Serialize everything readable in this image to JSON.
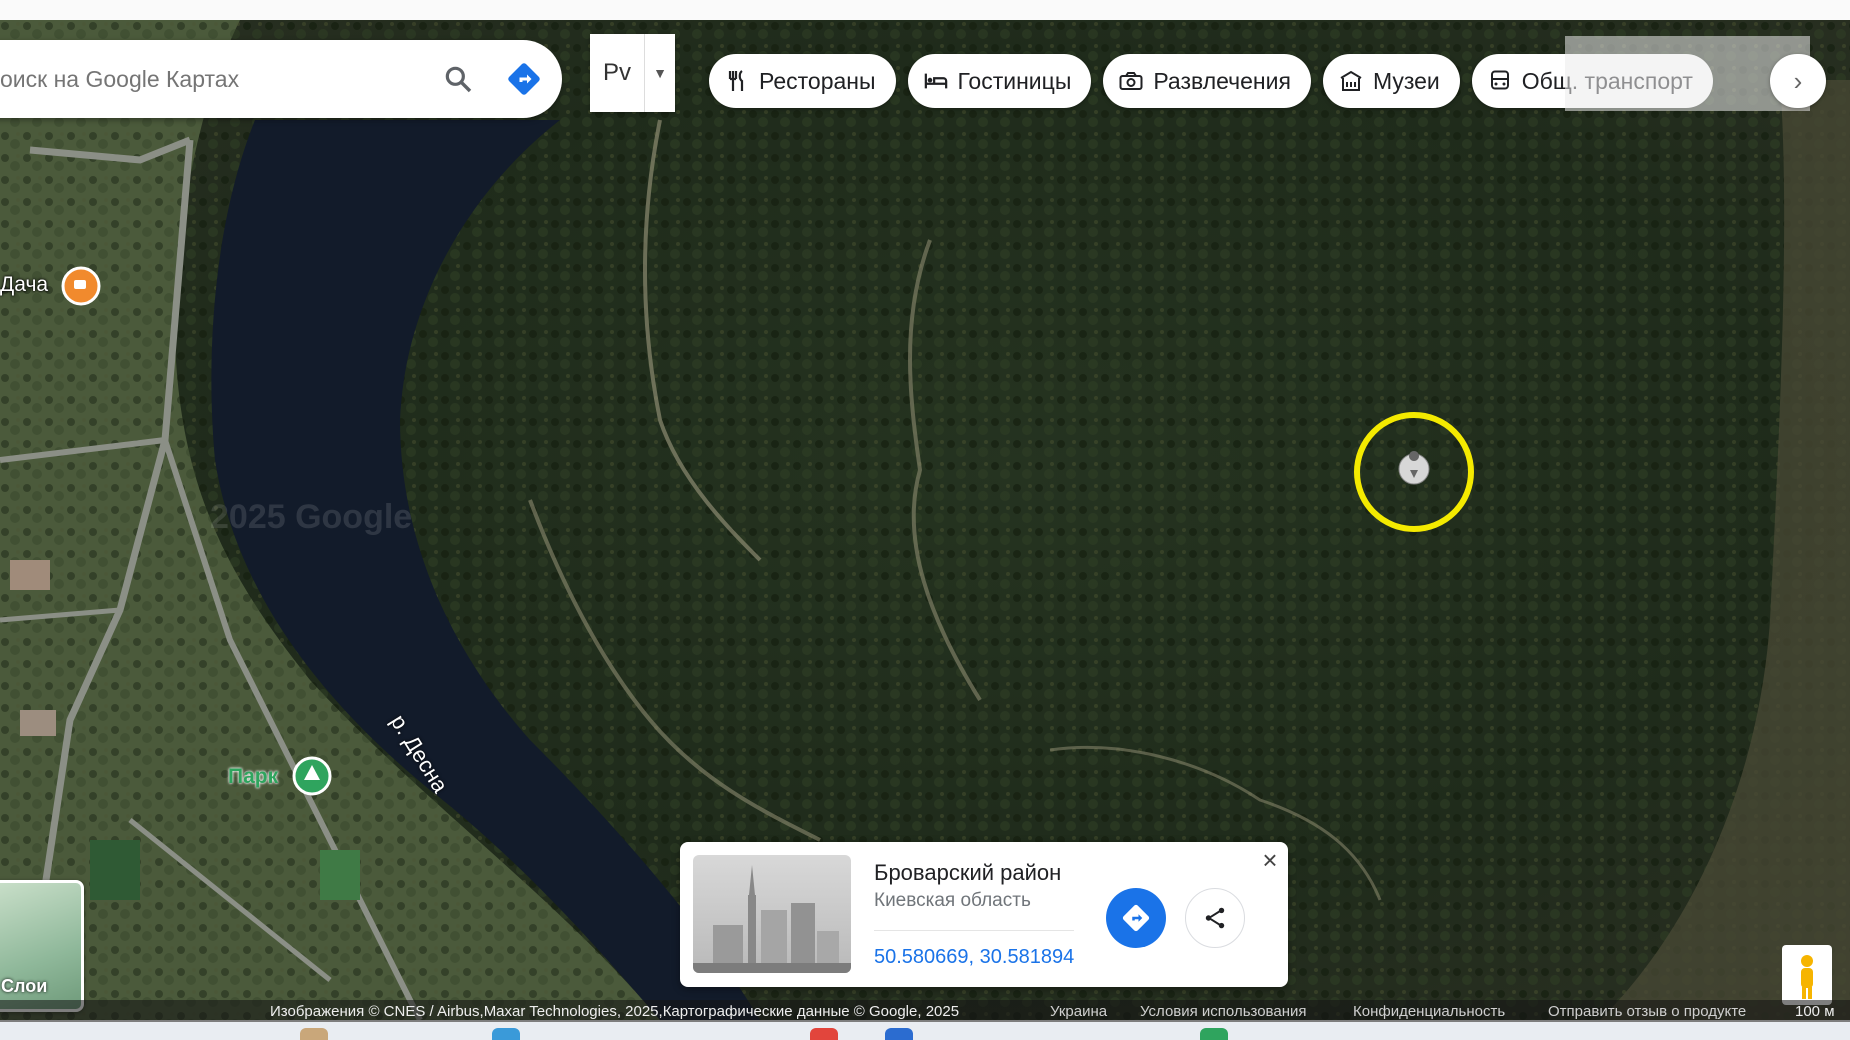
{
  "search": {
    "placeholder": "оиск на Google Картах"
  },
  "language": {
    "label": "Рv"
  },
  "chips": [
    {
      "label": "Рестораны",
      "icon": "fork-knife-icon"
    },
    {
      "label": "Гостиницы",
      "icon": "bed-icon"
    },
    {
      "label": "Развлечения",
      "icon": "camera-icon"
    },
    {
      "label": "Музеи",
      "icon": "museum-icon"
    },
    {
      "label": "Общ. транспорт",
      "icon": "bus-icon"
    }
  ],
  "map": {
    "labels": {
      "dacha": "Дача",
      "park": "Парк",
      "river": "р. Десна",
      "watermark": "2025 Google"
    },
    "layers_label": "Слои",
    "highlight_color": "#f4ea00",
    "river_color": "#121b2a"
  },
  "place_card": {
    "title": "Броварский район",
    "subtitle": "Киевская область",
    "coordinates": "50.580669, 30.581894",
    "accent": "#1a73e8"
  },
  "attribution": {
    "imagery": "Изображения © CNES / Airbus,Maxar Technologies, 2025,Картографические данные © Google, 2025",
    "country": "Украина",
    "terms": "Условия использования",
    "privacy": "Конфиденциальность",
    "feedback": "Отправить отзыв о продукте",
    "scale": "100 м"
  }
}
